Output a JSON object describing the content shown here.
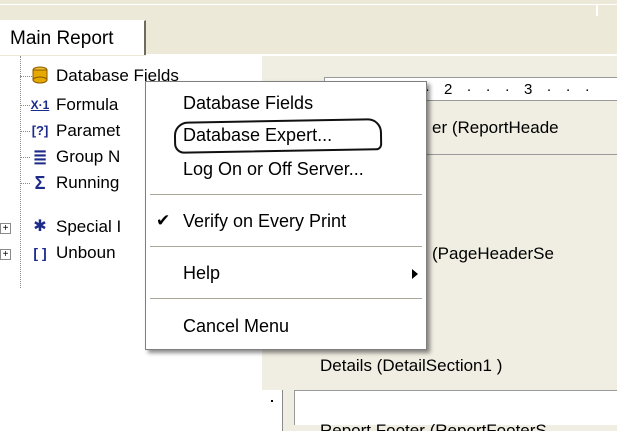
{
  "tabs": [
    {
      "label": "Main Report"
    }
  ],
  "tree": {
    "items": [
      {
        "label": "Database Fields",
        "icon": "database-icon",
        "icon_glyph": "●"
      },
      {
        "label": "Formula",
        "icon": "formula-icon",
        "icon_glyph": "X·1"
      },
      {
        "label": "Paramet",
        "icon": "parameter-icon",
        "icon_glyph": "[?]"
      },
      {
        "label": "Group N",
        "icon": "group-name-icon",
        "icon_glyph": "≣"
      },
      {
        "label": "Running",
        "icon": "running-total-icon",
        "icon_glyph": "Σ"
      },
      {
        "label": "Special I",
        "icon": "special-fields-icon",
        "icon_glyph": "✱"
      },
      {
        "label": "Unboun",
        "icon": "unbound-fields-icon",
        "icon_glyph": "[ ]"
      }
    ],
    "expanders": [
      "+",
      "+"
    ]
  },
  "canvas": {
    "ruler_text": "· · · · · · 2 · · · 3 · · ·",
    "sections": [
      {
        "label": "er  (ReportHeade"
      },
      {
        "label": "(PageHeaderSe"
      },
      {
        "label": "Details  (DetailSection1 )"
      },
      {
        "label": "Report Footer  (ReportFooterS"
      }
    ]
  },
  "context_menu": {
    "items": [
      {
        "label": "Database Fields",
        "checked": false,
        "submenu": false
      },
      {
        "label": "Database Expert...",
        "checked": false,
        "submenu": false,
        "highlighted_circle": true
      },
      {
        "label": "Log On or Off Server...",
        "checked": false,
        "submenu": false
      },
      {
        "label": "Verify on Every Print",
        "checked": true,
        "submenu": false
      },
      {
        "label": "Help",
        "checked": false,
        "submenu": true
      },
      {
        "label": "Cancel Menu",
        "checked": false,
        "submenu": false
      }
    ],
    "check_glyph": "✔"
  }
}
